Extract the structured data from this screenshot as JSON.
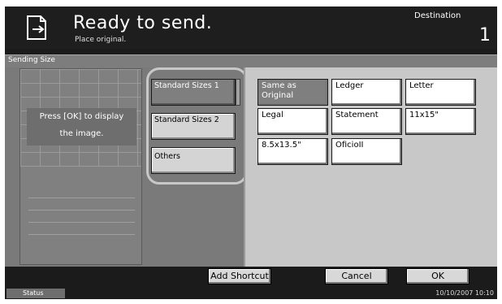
{
  "header": {
    "title": "Ready to send.",
    "subtitle": "Place original.",
    "destination_label": "Destination",
    "destination_count": "1",
    "icon": "send-document-icon"
  },
  "section": {
    "label": "Sending Size"
  },
  "preview": {
    "message_line1": "Press [OK] to display",
    "message_line2": "the image."
  },
  "tabs": [
    {
      "label": "Standard Sizes 1",
      "selected": true
    },
    {
      "label": "Standard Sizes 2",
      "selected": false
    },
    {
      "label": "Others",
      "selected": false
    }
  ],
  "sizes": [
    {
      "label": "Same as Original",
      "selected": true
    },
    {
      "label": "Ledger",
      "selected": false
    },
    {
      "label": "Letter",
      "selected": false
    },
    {
      "label": "Legal",
      "selected": false
    },
    {
      "label": "Statement",
      "selected": false
    },
    {
      "label": "11x15\"",
      "selected": false
    },
    {
      "label": "8.5x13.5\"",
      "selected": false
    },
    {
      "label": "OficioII",
      "selected": false
    }
  ],
  "footer": {
    "add_shortcut": "Add Shortcut",
    "cancel": "Cancel",
    "ok": "OK"
  },
  "statusbar": {
    "status": "Status",
    "datetime": "10/10/2007   10:10"
  }
}
